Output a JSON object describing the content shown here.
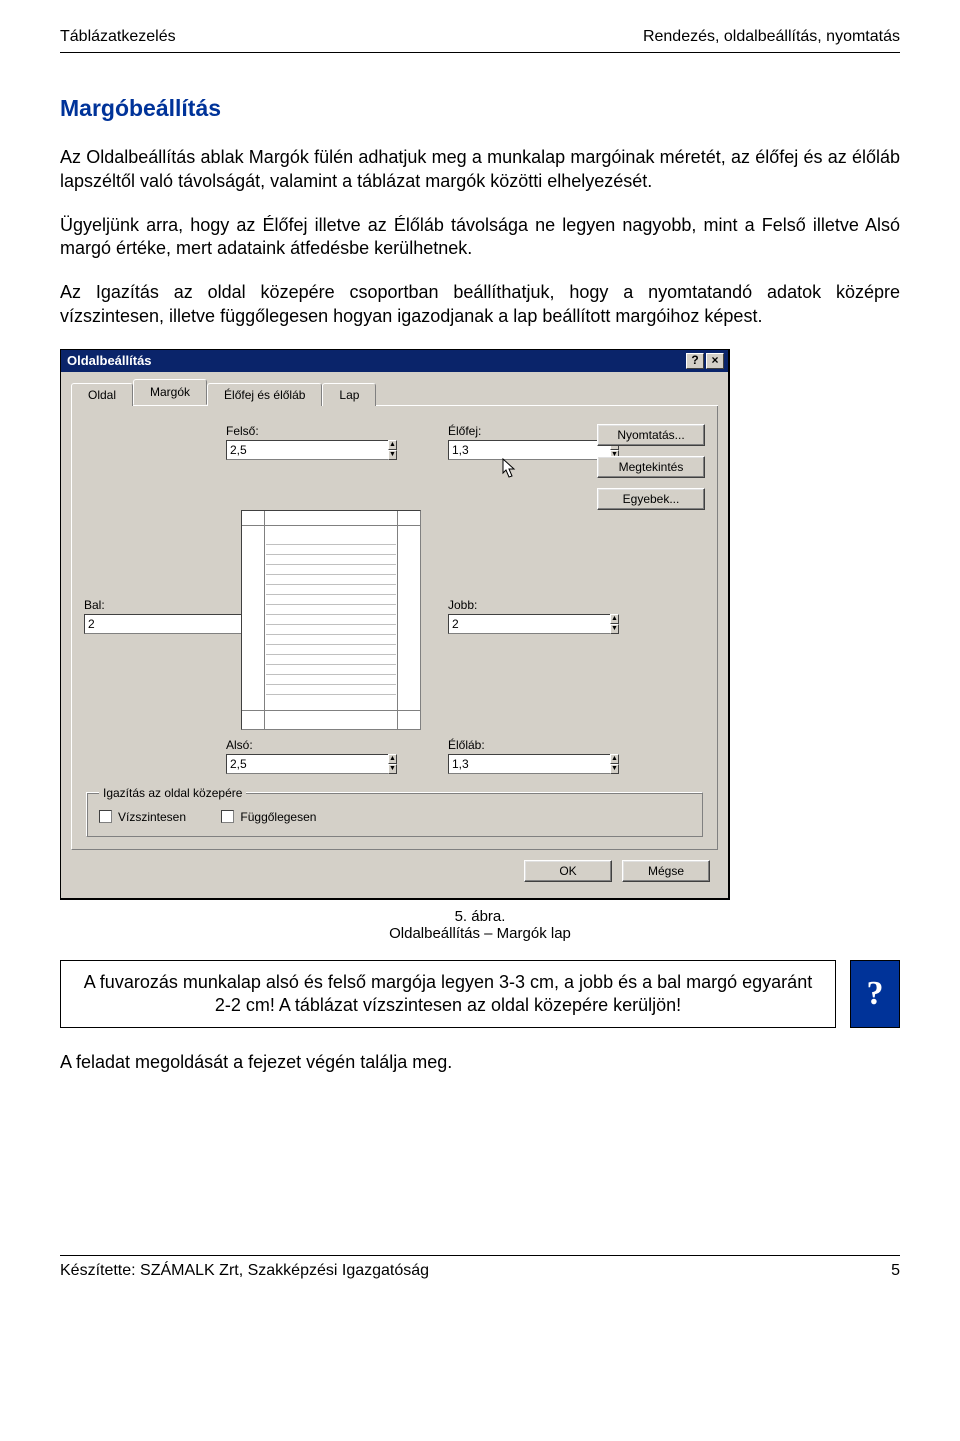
{
  "header": {
    "left": "Táblázatkezelés",
    "right": "Rendezés, oldalbeállítás, nyomtatás"
  },
  "heading": "Margóbeállítás",
  "para1": "Az Oldalbeállítás ablak Margók fülén adhatjuk meg a munkalap margóinak méretét, az élőfej és az élőláb lapszéltől való távolságát, valamint a táblázat margók közötti elhelyezését.",
  "para2": "Ügyeljünk arra, hogy az Élőfej illetve az Élőláb távolsága ne legyen nagyobb, mint a Felső illetve Alsó margó értéke, mert adataink átfedésbe kerülhetnek.",
  "para3": "Az Igazítás az oldal közepére csoportban beállíthatjuk, hogy a nyomtatandó adatok középre vízszintesen, illetve függőlegesen hogyan igazodjanak a lap beállított margóihoz képest.",
  "dialog": {
    "title": "Oldalbeállítás",
    "help": "?",
    "close": "×",
    "tabs": {
      "oldal": "Oldal",
      "margok": "Margók",
      "elofej": "Élőfej és élőláb",
      "lap": "Lap"
    },
    "labels": {
      "felso": "Felső:",
      "elofej": "Élőfej:",
      "bal": "Bal:",
      "jobb": "Jobb:",
      "also": "Alsó:",
      "elolab": "Élőláb:"
    },
    "values": {
      "felso": "2,5",
      "elofej": "1,3",
      "bal": "2",
      "jobb": "2",
      "also": "2,5",
      "elolab": "1,3"
    },
    "buttons": {
      "nyomtatas": "Nyomtatás...",
      "megtekintes": "Megtekintés",
      "egyebek": "Egyebek..."
    },
    "group_legend": "Igazítás az oldal közepére",
    "chk_h": "Vízszintesen",
    "chk_v": "Függőlegesen",
    "ok": "OK",
    "cancel": "Mégse"
  },
  "caption_num": "5. ábra.",
  "caption_txt": "Oldalbeállítás – Margók lap",
  "task": "A fuvarozás munkalap alsó és felső margója legyen 3-3 cm, a jobb és a bal margó egyaránt 2-2 cm! A táblázat vízszintesen az oldal közepére kerüljön!",
  "qmark": "?",
  "closing": "A feladat megoldását a fejezet végén találja meg.",
  "footer": {
    "left": "Készítette: SZÁMALK Zrt, Szakképzési Igazgatóság",
    "right": "5"
  }
}
